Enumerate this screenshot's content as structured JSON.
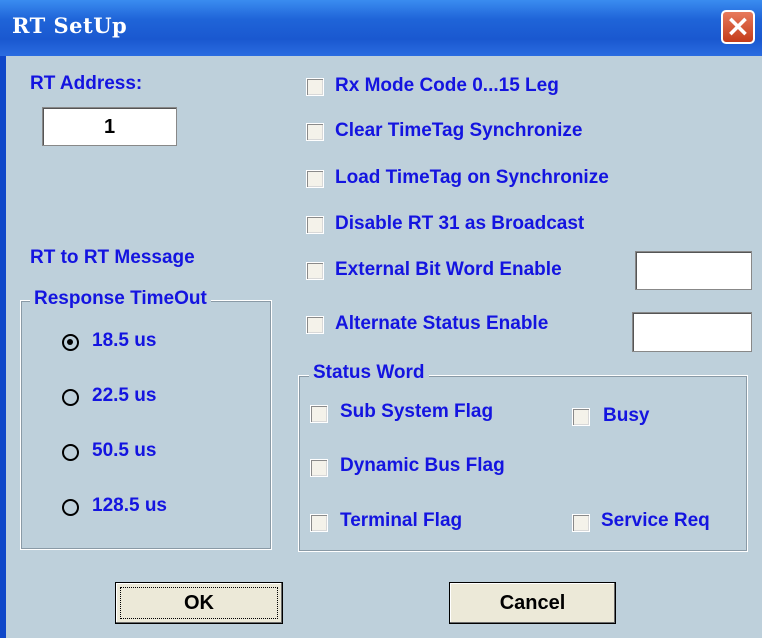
{
  "window": {
    "title": "RT SetUp",
    "close_label": "×"
  },
  "rt_address": {
    "label": "RT Address:",
    "value": "1"
  },
  "rt_to_rt": {
    "label": "RT to RT Message"
  },
  "response_timeout": {
    "legend": "Response TimeOut",
    "options": [
      {
        "label": "18.5 us",
        "selected": true
      },
      {
        "label": "22.5 us",
        "selected": false
      },
      {
        "label": "50.5 us",
        "selected": false
      },
      {
        "label": "128.5 us",
        "selected": false
      }
    ]
  },
  "options": [
    {
      "label": "Rx  Mode Code 0...15 Leg",
      "checked": false
    },
    {
      "label": "Clear TimeTag Synchronize",
      "checked": false
    },
    {
      "label": "Load TimeTag on Synchronize",
      "checked": false
    },
    {
      "label": "Disable RT 31 as Broadcast",
      "checked": false
    },
    {
      "label": "External Bit Word Enable",
      "checked": false,
      "value": ""
    },
    {
      "label": "Alternate Status Enable",
      "checked": false,
      "value": ""
    }
  ],
  "status_word": {
    "legend": "Status Word",
    "flags": [
      {
        "label": "Sub System Flag",
        "checked": false
      },
      {
        "label": "Busy",
        "checked": false
      },
      {
        "label": "Dynamic Bus Flag",
        "checked": false
      },
      {
        "label": "Terminal Flag",
        "checked": false
      },
      {
        "label": "Service Req",
        "checked": false
      }
    ]
  },
  "buttons": {
    "ok": "OK",
    "cancel": "Cancel"
  },
  "colors": {
    "title_bar": "#1f64d8",
    "dialog_bg": "#bed0db",
    "label_text": "#1414e0",
    "close_button": "#c43c1a"
  }
}
